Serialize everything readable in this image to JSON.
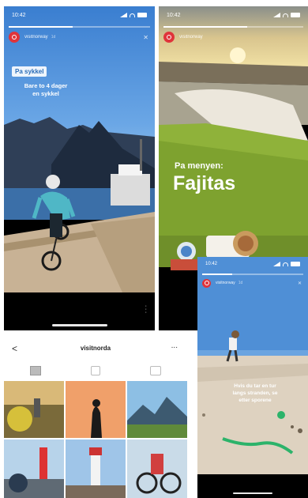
{
  "status": {
    "time": "10:42"
  },
  "story1": {
    "account": "visitnorway",
    "time_ago": "1d",
    "tag": "Pa sykkel",
    "caption_line1": "Bare to 4 dager",
    "caption_line2": "en sykkel",
    "progress": 0.45
  },
  "story2": {
    "account": "visitnorway",
    "kicker": "Pa menyen:",
    "title": "Fajitas",
    "progress": 0.6
  },
  "story3": {
    "account": "visitnorway",
    "time_ago": "1d",
    "caption_line1": "Hvis du tar en tur",
    "caption_line2": "langs stranden, se",
    "caption_line3": "etter sporene",
    "progress": 0.3
  },
  "profile": {
    "username": "visitnorda",
    "more_label": "...",
    "back_label": "<"
  },
  "colors": {
    "brand_red": "#e0343b",
    "sky_blue": "#4f8fd6",
    "grass": "#8fb23a",
    "sand": "#ded2c0"
  },
  "icons": [
    "back-arrow-icon",
    "more-icon",
    "grid-icon",
    "reels-icon",
    "tagged-icon",
    "close-icon"
  ]
}
